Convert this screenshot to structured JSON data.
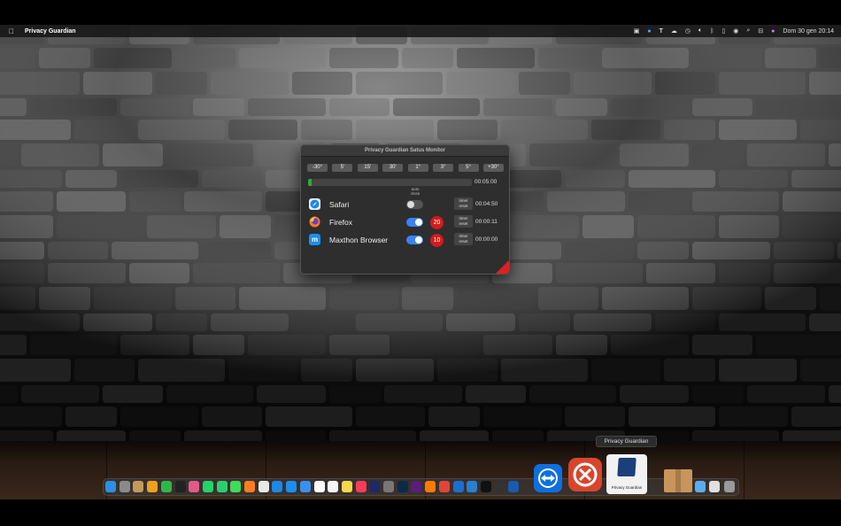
{
  "menubar": {
    "app_name": "Privacy Guardian",
    "apple_icon": "apple-icon",
    "status_icons": [
      "screen-icon",
      "p-icon",
      "t-icon",
      "cloud-icon",
      "clock-icon",
      "volume-icon",
      "bluetooth-icon",
      "battery-icon",
      "user-icon",
      "search-icon",
      "control-center-icon",
      "siri-icon"
    ],
    "datetime": "Dom 30 gen  20:14"
  },
  "window": {
    "title": "Privacy Guardian Satus Monitor",
    "time_buttons": [
      "-30°",
      "5'",
      "15'",
      "30'",
      "1°",
      "3°",
      "5°",
      "+30°"
    ],
    "progress_fraction": 0.02,
    "total_time": "00:05:00",
    "autoclose_label_1": "auto",
    "autoclose_label_2": "close",
    "apps": [
      {
        "name": "Safari",
        "icon": "safari-icon",
        "auto_close": false,
        "badge": "",
        "reset_1": "timer",
        "reset_2": "reset",
        "time": "00:04:50"
      },
      {
        "name": "Firefox",
        "icon": "firefox-icon",
        "auto_close": true,
        "badge": "20",
        "reset_1": "timer",
        "reset_2": "reset",
        "time": "00:00:11"
      },
      {
        "name": "Maxthon Browser",
        "icon": "maxthon-icon",
        "auto_close": true,
        "badge": "10",
        "reset_1": "timer",
        "reset_2": "reset",
        "time": "00:00:00"
      }
    ]
  },
  "dock": {
    "tooltip": "Privacy Guardian",
    "privacy_guardian_label": "Privacy Guardian"
  },
  "colors": {
    "accent_blue": "#3b82f6",
    "badge_red": "#d21c1c",
    "progress_green": "#2faa3b"
  }
}
